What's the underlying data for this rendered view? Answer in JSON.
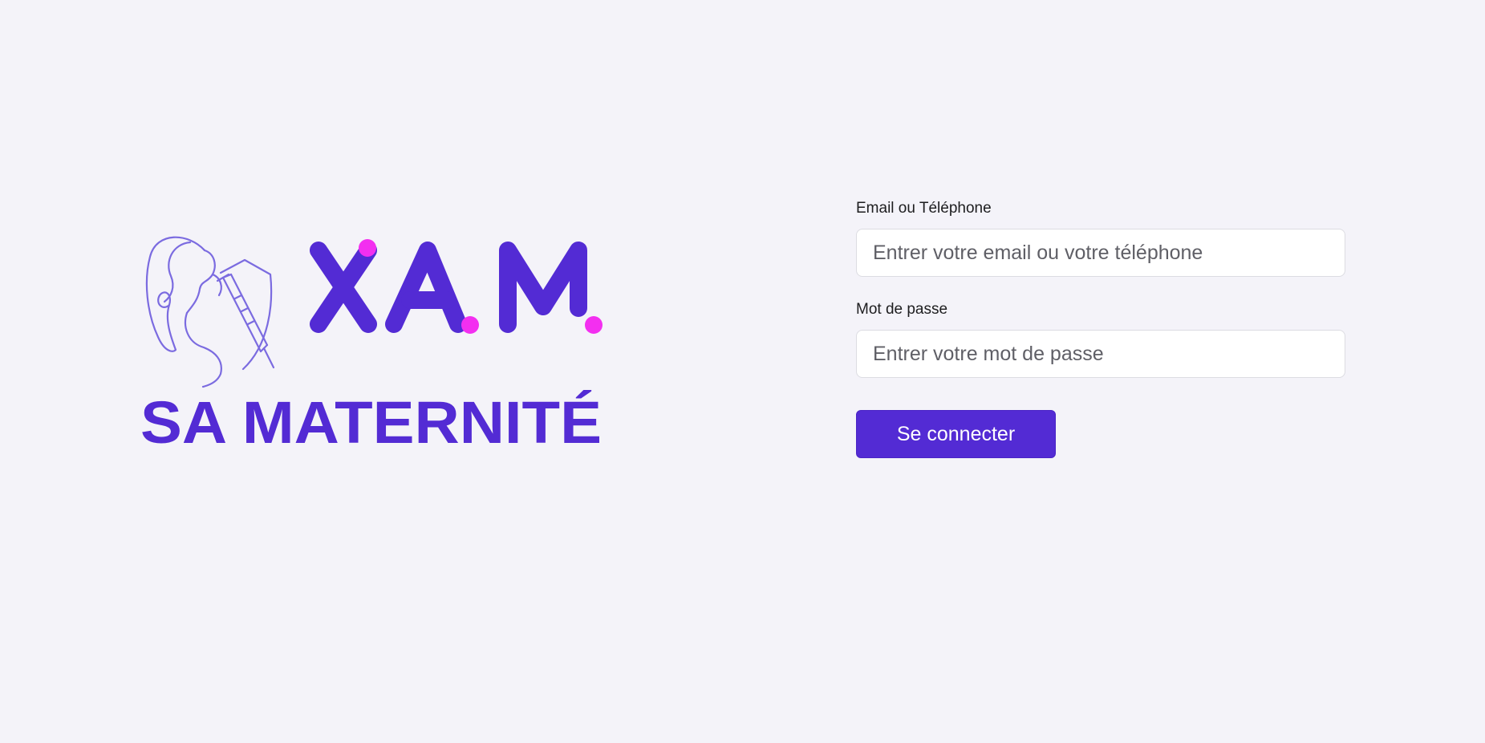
{
  "logo": {
    "mark_text": "XAM",
    "tagline": "SA MATERNITÉ",
    "colors": {
      "primary": "#532bd4",
      "accent_dot": "#f32ff0",
      "outline": "#7b6be0"
    },
    "icon": "pregnant-woman-shield-syringe-icon"
  },
  "form": {
    "email": {
      "label": "Email ou Téléphone",
      "placeholder": "Entrer votre email ou votre téléphone",
      "value": ""
    },
    "password": {
      "label": "Mot de passe",
      "placeholder": "Entrer votre mot de passe",
      "value": ""
    },
    "submit_label": "Se connecter"
  }
}
